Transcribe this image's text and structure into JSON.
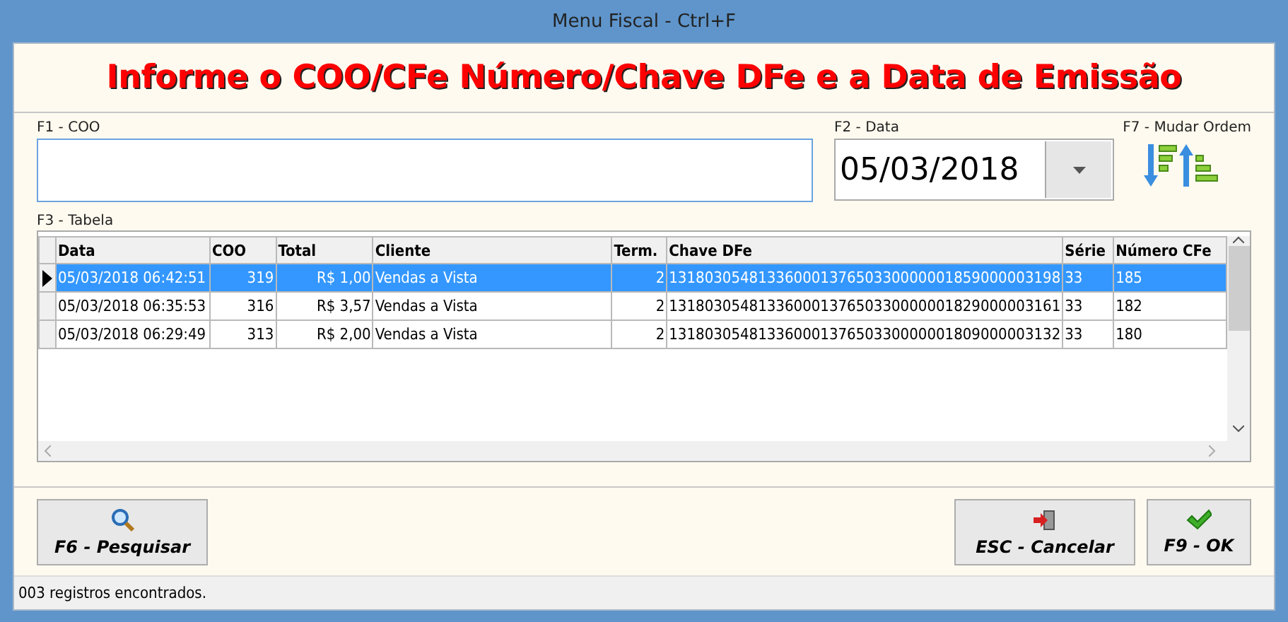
{
  "window": {
    "title": "Menu Fiscal - Ctrl+F"
  },
  "heading": "Informe o COO/CFe Número/Chave DFe e a Data de Emissão",
  "coo_field": {
    "label": "F1 - COO"
  },
  "date_field": {
    "label": "F2 - Data",
    "value": "05/03/2018"
  },
  "order_button": {
    "label": "F7 - Mudar Ordem"
  },
  "table": {
    "label": "F3 - Tabela",
    "columns": [
      {
        "title": "Data"
      },
      {
        "title": "COO"
      },
      {
        "title": "Total"
      },
      {
        "title": "Cliente"
      },
      {
        "title": "Term."
      },
      {
        "title": "Chave DFe"
      },
      {
        "title": "Série"
      },
      {
        "title": "Número CFe"
      }
    ],
    "rows": [
      {
        "selected": true,
        "cells": [
          "05/03/2018 06:42:51",
          "319",
          "R$ 1,00",
          "Vendas a Vista",
          "2",
          "13180305481336000137650330000001859000003198",
          "33",
          "185"
        ]
      },
      {
        "selected": false,
        "cells": [
          "05/03/2018 06:35:53",
          "316",
          "R$ 3,57",
          "Vendas a Vista",
          "2",
          "13180305481336000137650330000001829000003161",
          "33",
          "182"
        ]
      },
      {
        "selected": false,
        "cells": [
          "05/03/2018 06:29:49",
          "313",
          "R$ 2,00",
          "Vendas a Vista",
          "2",
          "13180305481336000137650330000001809000003132",
          "33",
          "180"
        ]
      }
    ]
  },
  "buttons": [
    {
      "kind": "search",
      "label": "F6 - Pesquisar"
    },
    {
      "kind": "cancel",
      "label": "ESC - Cancelar"
    },
    {
      "kind": "ok",
      "label": "F9 - OK"
    }
  ],
  "status_bar": "003 registros encontrados."
}
